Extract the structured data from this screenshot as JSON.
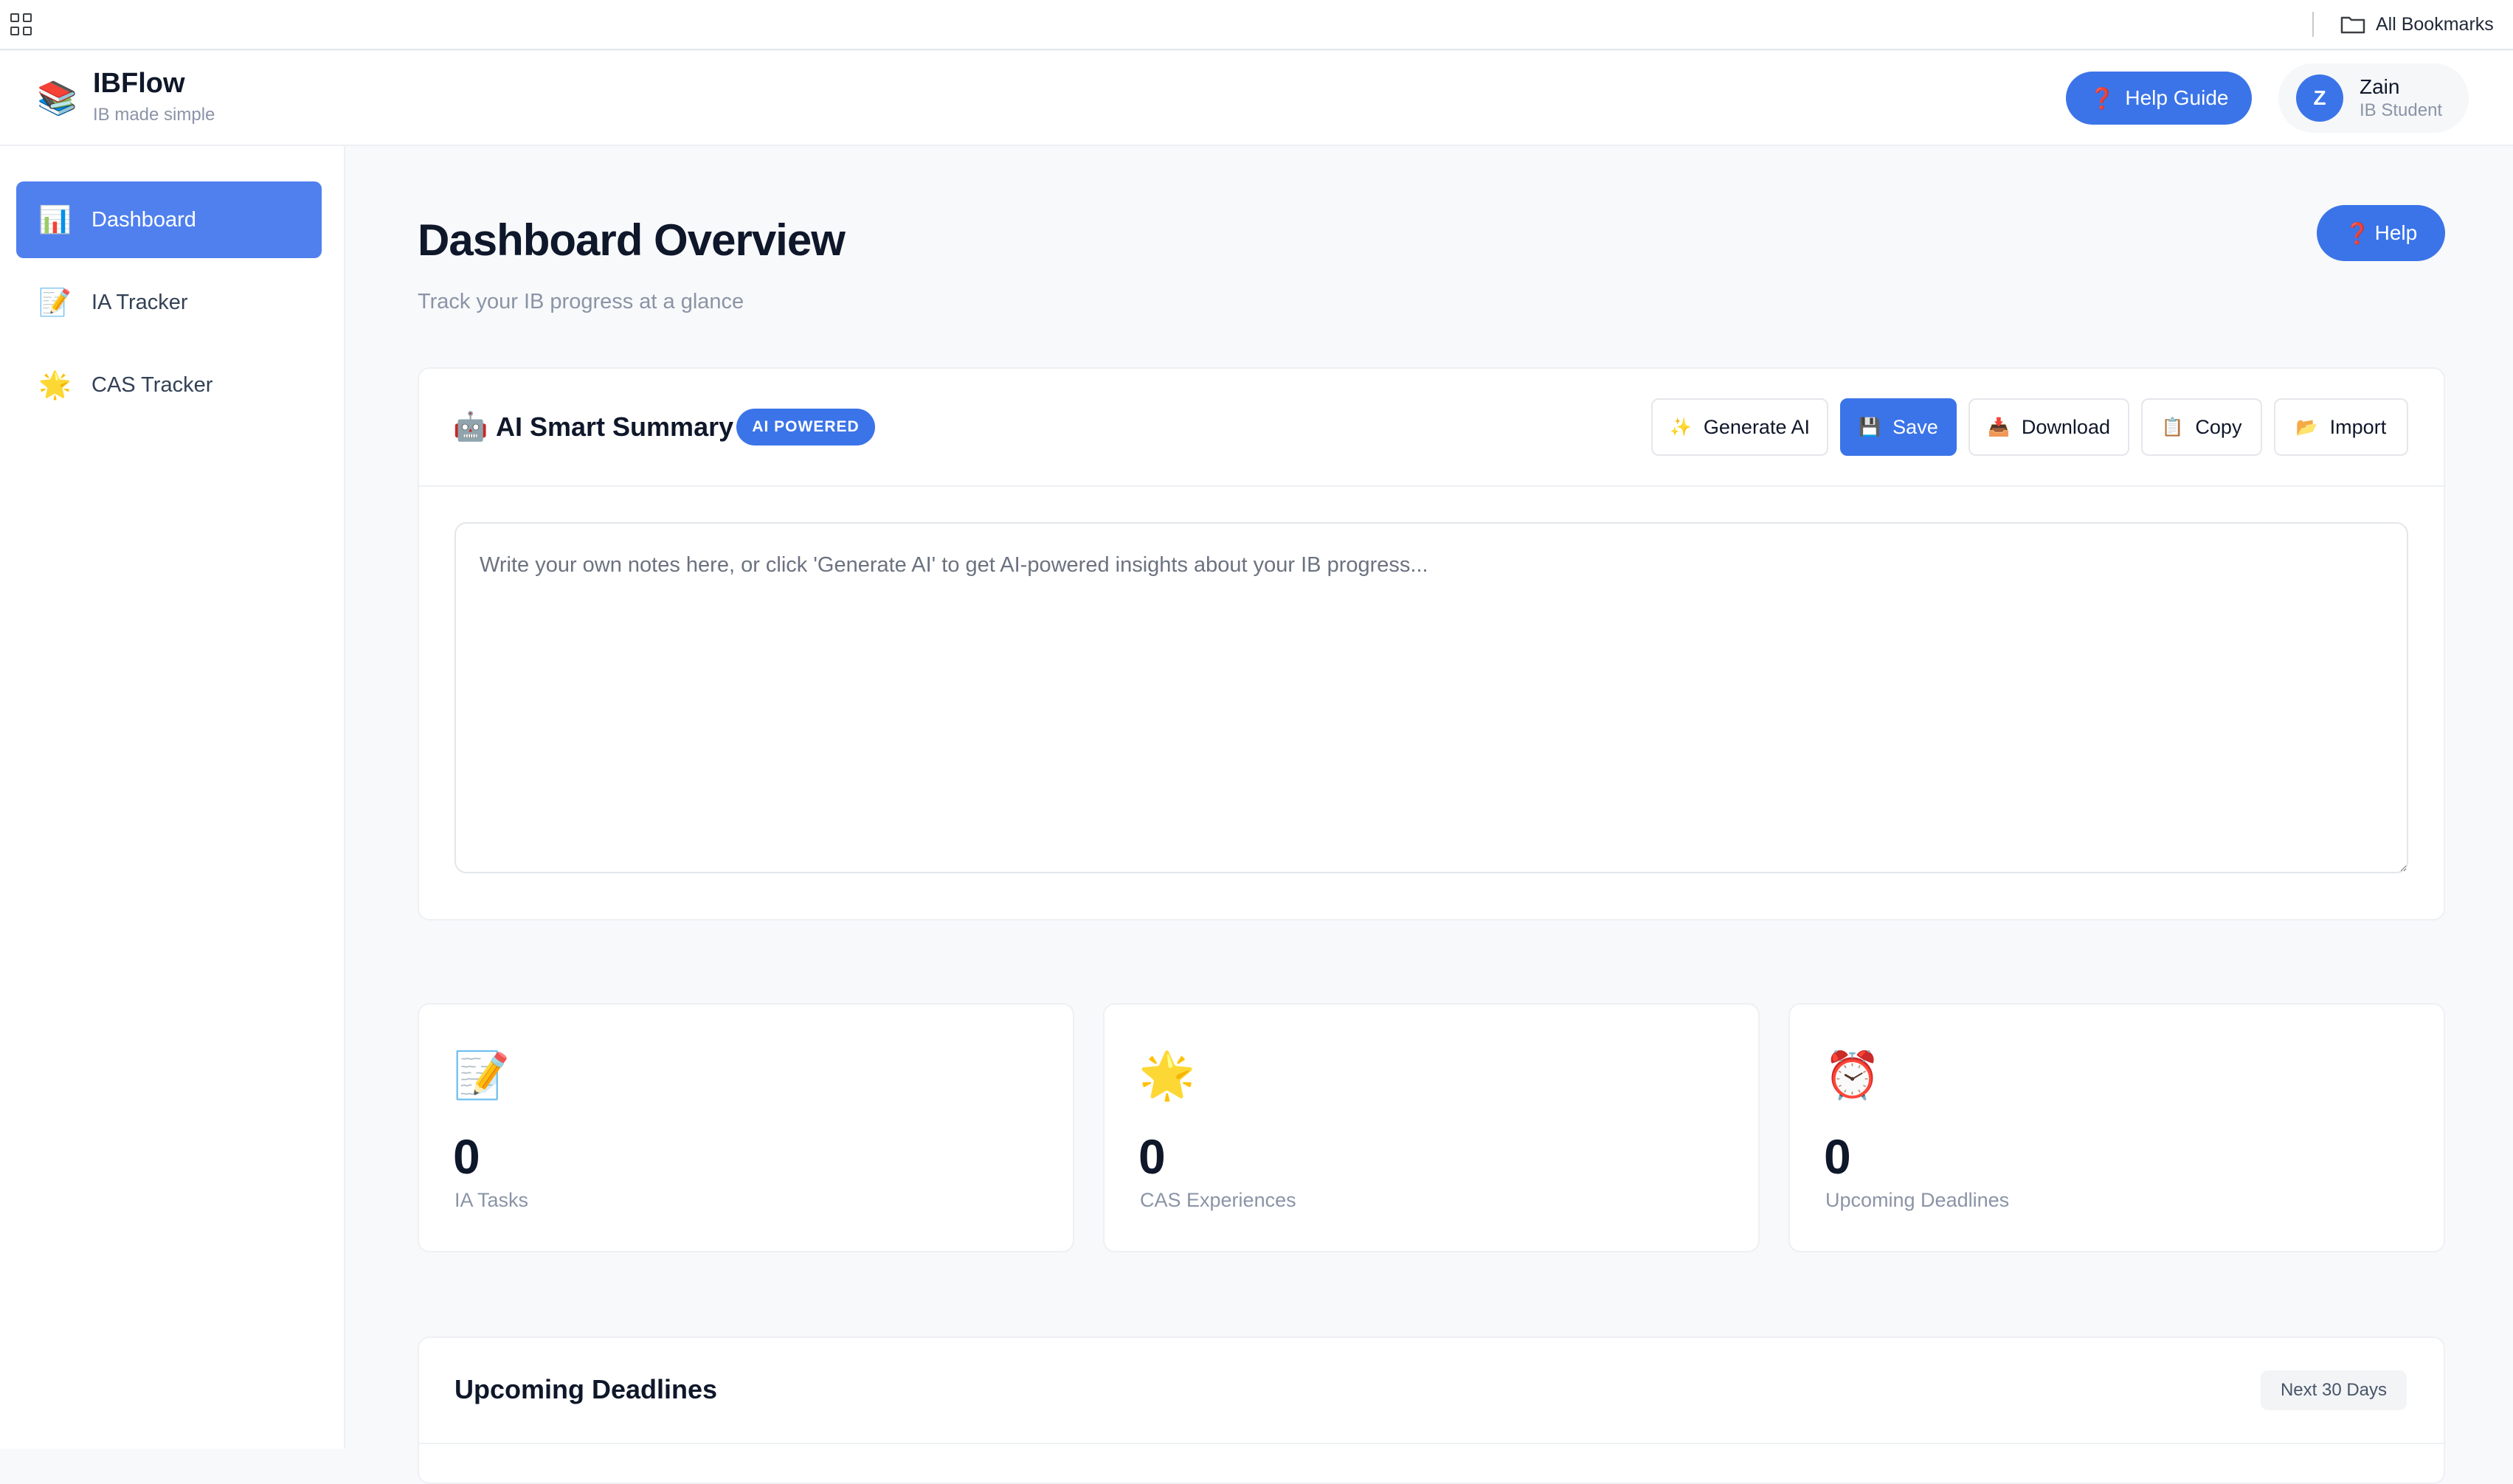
{
  "bookmarks_bar": {
    "all_bookmarks_label": "All Bookmarks"
  },
  "header": {
    "logo_emoji": "📚",
    "brand": "IBFlow",
    "tagline": "IB made simple",
    "help_guide_icon": "❓",
    "help_guide_label": "Help Guide",
    "user": {
      "avatar_initial": "Z",
      "name": "Zain",
      "role": "IB Student"
    }
  },
  "sidebar": {
    "items": [
      {
        "icon": "📊",
        "label": "Dashboard",
        "active": true
      },
      {
        "icon": "📝",
        "label": "IA Tracker",
        "active": false
      },
      {
        "icon": "🌟",
        "label": "CAS Tracker",
        "active": false
      }
    ]
  },
  "main": {
    "title": "Dashboard Overview",
    "subtitle": "Track your IB progress at a glance",
    "help_icon": "❓",
    "help_label": "Help",
    "summary": {
      "emoji": "🤖",
      "title": "AI Smart Summary",
      "badge": "AI POWERED",
      "buttons": [
        {
          "icon": "✨",
          "label": "Generate AI"
        },
        {
          "icon": "💾",
          "label": "Save"
        },
        {
          "icon": "📥",
          "label": "Download"
        },
        {
          "icon": "📋",
          "label": "Copy"
        },
        {
          "icon": "📂",
          "label": "Import"
        }
      ],
      "notes_value": "",
      "notes_placeholder": "Write your own notes here, or click 'Generate AI' to get AI-powered insights about your IB progress..."
    },
    "stats": [
      {
        "icon": "📝",
        "value": "0",
        "label": "IA Tasks"
      },
      {
        "icon": "🌟",
        "value": "0",
        "label": "CAS Experiences"
      },
      {
        "icon": "⏰",
        "value": "0",
        "label": "Upcoming Deadlines"
      }
    ],
    "deadlines": {
      "title": "Upcoming Deadlines",
      "range": "Next 30 Days"
    }
  },
  "colors": {
    "accent": "#3b74e8",
    "sidebar_active": "#4f80ee",
    "page_bg": "#f8f9fb"
  }
}
